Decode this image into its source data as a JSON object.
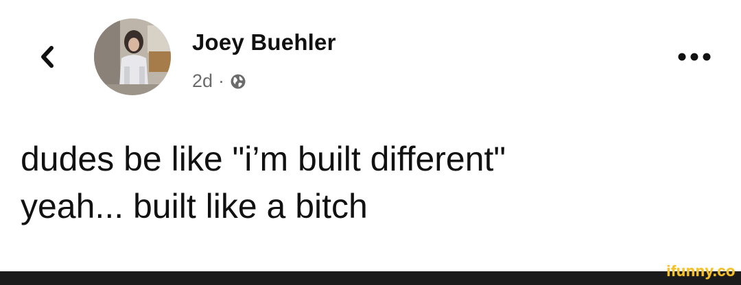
{
  "post": {
    "author_name": "Joey Buehler",
    "timestamp": "2d",
    "separator": "·",
    "privacy_icon": "globe-icon",
    "text_lines": [
      "dudes be like \"i’m built different\"",
      "yeah... built like a bitch"
    ]
  },
  "header": {
    "back_icon": "chevron-left-icon",
    "more_icon": "more-horizontal-icon"
  },
  "watermark": {
    "text": "ifunny.co"
  },
  "colors": {
    "background": "#ffffff",
    "text": "#111111",
    "meta_text": "#6b6b6b",
    "footer_bar": "#1b1b1b",
    "watermark": "#f6c12b"
  }
}
